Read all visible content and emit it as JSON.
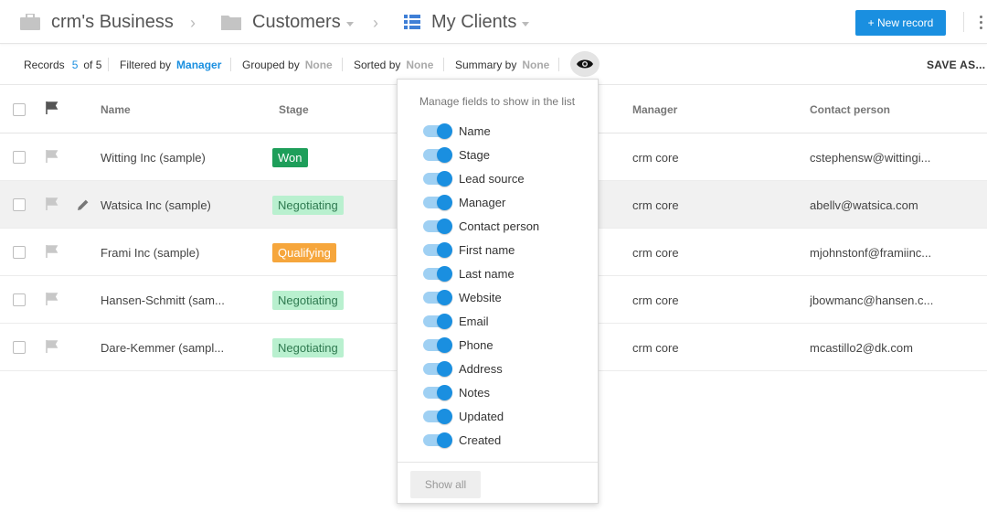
{
  "breadcrumb": {
    "business": "crm's Business",
    "folder": "Customers",
    "view": "My Clients"
  },
  "toolbar": {
    "new_record": "+ New record",
    "save_as": "SAVE AS..."
  },
  "filters": {
    "records_label": "Records",
    "records_count": "5",
    "records_total": "of 5",
    "filtered_label": "Filtered by",
    "filtered_value": "Manager",
    "grouped_label": "Grouped by",
    "grouped_value": "None",
    "sorted_label": "Sorted by",
    "sorted_value": "None",
    "summary_label": "Summary by",
    "summary_value": "None"
  },
  "table": {
    "headers": {
      "name": "Name",
      "stage": "Stage",
      "manager": "Manager",
      "contact": "Contact person"
    },
    "rows": [
      {
        "name": "Witting Inc (sample)",
        "stage": "Won",
        "manager": "crm core",
        "contact": "cstephensw@wittingi..."
      },
      {
        "name": "Watsica Inc (sample)",
        "stage": "Negotiating",
        "manager": "crm core",
        "contact": "abellv@watsica.com"
      },
      {
        "name": "Frami Inc (sample)",
        "stage": "Qualifying",
        "manager": "crm core",
        "contact": "mjohnstonf@framiinc..."
      },
      {
        "name": "Hansen-Schmitt (sam...",
        "stage": "Negotiating",
        "manager": "crm core",
        "contact": "jbowmanc@hansen.c..."
      },
      {
        "name": "Dare-Kemmer (sampl...",
        "stage": "Negotiating",
        "manager": "crm core",
        "contact": "mcastillo2@dk.com"
      }
    ]
  },
  "fields_popup": {
    "title": "Manage fields to show in the list",
    "fields": [
      "Name",
      "Stage",
      "Lead source",
      "Manager",
      "Contact person",
      "First name",
      "Last name",
      "Website",
      "Email",
      "Phone",
      "Address",
      "Notes",
      "Updated",
      "Created"
    ],
    "show_all": "Show all"
  },
  "colors": {
    "accent": "#1a8fe0",
    "won": "#1e9e5a",
    "negotiating": "#b9f0cf",
    "qualifying": "#f6a63c"
  }
}
